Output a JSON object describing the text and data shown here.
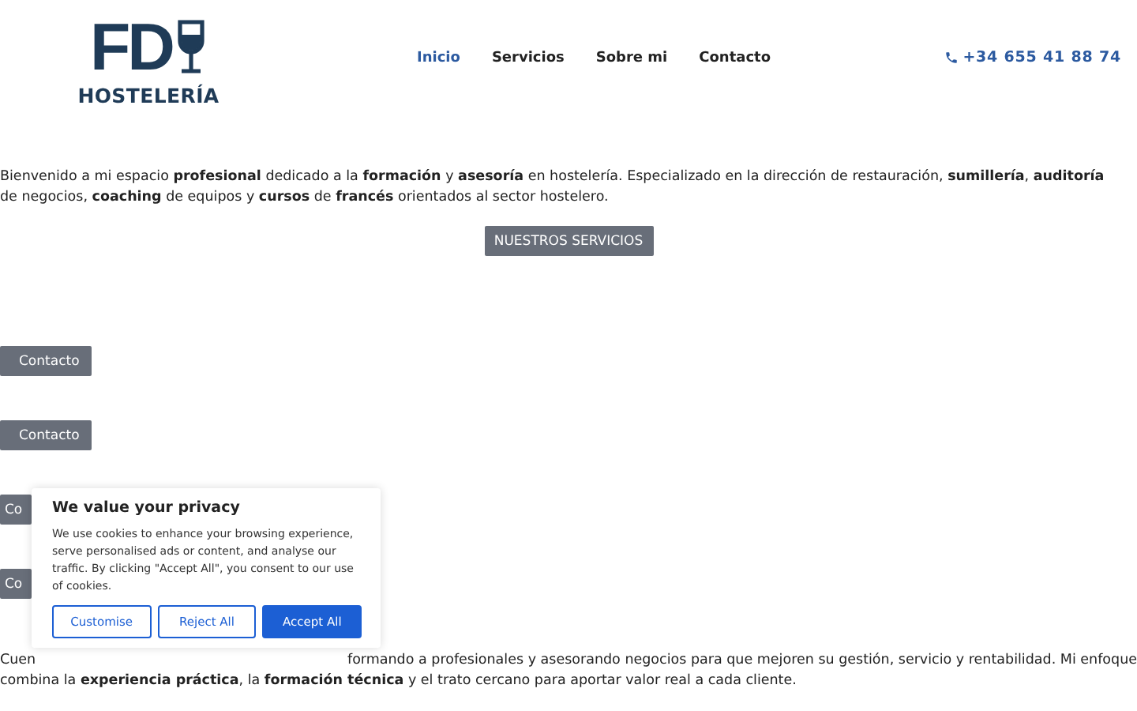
{
  "header": {
    "logo": {
      "initials": "FD",
      "name": "HOSTELERÍA"
    },
    "nav": [
      {
        "label": "Inicio",
        "selected": true
      },
      {
        "label": "Servicios",
        "selected": false
      },
      {
        "label": "Sobre mi",
        "selected": false
      },
      {
        "label": "Contacto",
        "selected": false
      }
    ],
    "phone": "+34 655 41 88 74"
  },
  "intro": "Bienvenido a mi espacio **profesional** dedicado a la **formación** y **asesoría** en hostelería. Especializado en la dirección de restauración, **sumillería**, **auditoría** de negocios, **coaching** de equipos y **cursos** de **francés** orientados al sector hostelero.",
  "services_button": "NUESTROS SERVICIOS",
  "contact_buttons": [
    "Contacto",
    "Contacto",
    "Co",
    "Co"
  ],
  "about": {
    "line_1_start": "Cuen",
    "line_1_end": "formando a profesionales y asesorando negocios para que mejoren su gestión, servicio y rentabilidad. Mi enfoque",
    "line_2": "combina la **experiencia práctica**, la **formación técnica** y el trato cercano para aportar valor real a cada cliente."
  },
  "cookie_banner": {
    "title": "We value your privacy",
    "text": "We use cookies to enhance your browsing experience, serve personalised ads or content, and analyse our traffic. By clicking \"Accept All\", you consent to our use of cookies.",
    "buttons": [
      {
        "label": "Customise",
        "kind": "outline"
      },
      {
        "label": "Reject All",
        "kind": "outline"
      },
      {
        "label": "Accept All",
        "kind": "primary"
      }
    ]
  }
}
